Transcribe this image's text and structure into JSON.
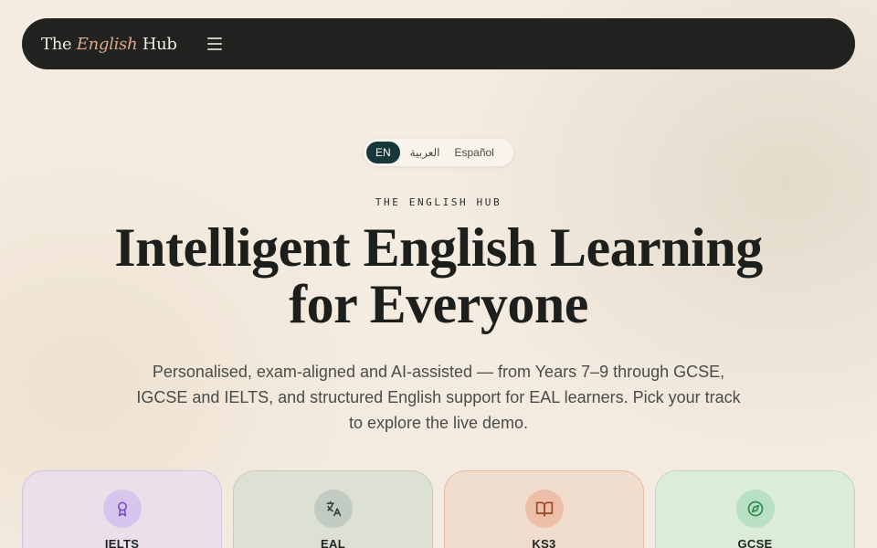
{
  "nav": {
    "brand_prefix": "The",
    "brand_accent": "English",
    "brand_suffix": "Hub",
    "menu_icon": "menu-icon"
  },
  "languages": {
    "options": [
      "EN",
      "العربية",
      "Español"
    ],
    "selected": "EN"
  },
  "hero": {
    "eyebrow": "THE ENGLISH HUB",
    "headline_line1": "Intelligent English Learning",
    "headline_line2": "for Everyone",
    "subtext": "Personalised, exam-aligned and AI-assisted — from Years 7–9 through GCSE, IGCSE and IELTS, and structured English support for EAL learners. Pick your track to explore the live demo."
  },
  "tracks": [
    {
      "label": "IELTS",
      "icon": "award-icon",
      "color": "#7a4fc4"
    },
    {
      "label": "EAL",
      "icon": "translate-icon",
      "color": "#2f3a34"
    },
    {
      "label": "KS3",
      "icon": "book-open-icon",
      "color": "#a4432a"
    },
    {
      "label": "GCSE",
      "icon": "compass-icon",
      "color": "#2f8a52"
    }
  ],
  "colors": {
    "nav_bg": "#20231f",
    "brand_accent": "#e0a58a",
    "active_lang_bg": "#16383a",
    "page_bg": "#f3ebe0"
  }
}
